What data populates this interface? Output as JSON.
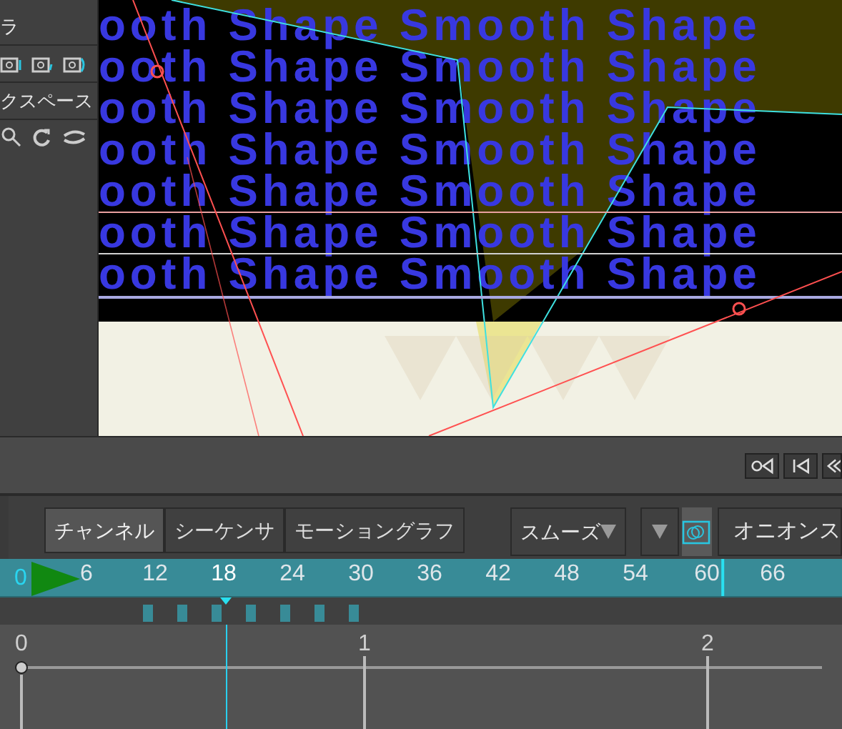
{
  "sidebar": {
    "rows": [
      {
        "kind": "label",
        "text": "ラ"
      },
      {
        "kind": "camera-tools"
      },
      {
        "kind": "label",
        "text": "クスペース"
      },
      {
        "kind": "view-tools"
      }
    ]
  },
  "viewer": {
    "text_lines": [
      "ooth Shape Smooth Shape",
      "ooth Shape Smooth Shape",
      "ooth Shape Smooth Shape",
      "ooth Shape Smooth Shape",
      "ooth Shape Smooth Shape",
      "ooth Shape Smooth Shape",
      "ooth Shape Smooth Shape"
    ]
  },
  "function_editor": {
    "tabs": [
      {
        "label": "チャンネル",
        "selected": true
      },
      {
        "label": "シーケンサ",
        "selected": false
      },
      {
        "label": "モーショングラフ",
        "selected": false
      }
    ],
    "interpolation": {
      "value": "スムーズ"
    },
    "onion_skin": {
      "on": true
    },
    "onion_button": "オニオンス",
    "ruler": {
      "start": "0",
      "ticks": [
        {
          "label": "6",
          "selected": false,
          "marked": false
        },
        {
          "label": "12",
          "selected": false,
          "marked": false
        },
        {
          "label": "18",
          "selected": true,
          "marked": false
        },
        {
          "label": "24",
          "selected": false,
          "marked": false
        },
        {
          "label": "30",
          "selected": false,
          "marked": false
        },
        {
          "label": "36",
          "selected": false,
          "marked": false
        },
        {
          "label": "42",
          "selected": false,
          "marked": false
        },
        {
          "label": "48",
          "selected": false,
          "marked": false
        },
        {
          "label": "54",
          "selected": false,
          "marked": false
        },
        {
          "label": "60",
          "selected": false,
          "marked": true
        },
        {
          "label": "66",
          "selected": false,
          "marked": false
        }
      ]
    },
    "graph": {
      "labels": [
        "0",
        "1",
        "2"
      ]
    }
  }
}
